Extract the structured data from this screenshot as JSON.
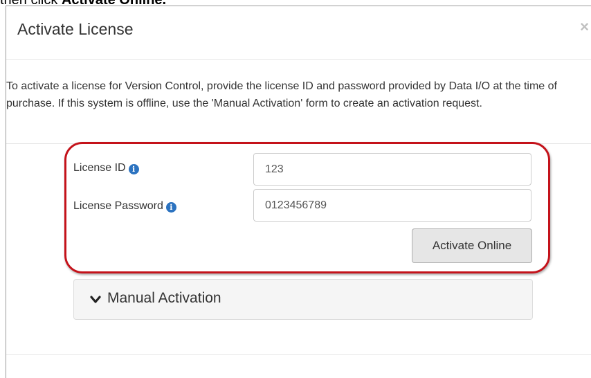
{
  "document": {
    "prefix": "then click ",
    "emphasis": "Activate Online."
  },
  "modal": {
    "title": "Activate License",
    "close_label": "×",
    "description": "To activate a license for Version Control, provide the license ID and password provided by Data I/O at the time of purchase. If this system is offline, use the 'Manual Activation' form to create an activation request."
  },
  "form": {
    "license_id": {
      "label": "License ID",
      "value": "123"
    },
    "license_password": {
      "label": "License Password",
      "value": "0123456789"
    },
    "info_glyph": "i",
    "activate_button": "Activate Online"
  },
  "manual_activation": {
    "label": "Manual Activation",
    "icon": "chevron-down-icon"
  },
  "colors": {
    "highlight": "#c4121a",
    "info_icon": "#2c73c0",
    "button_bg": "#e6e6e6"
  }
}
